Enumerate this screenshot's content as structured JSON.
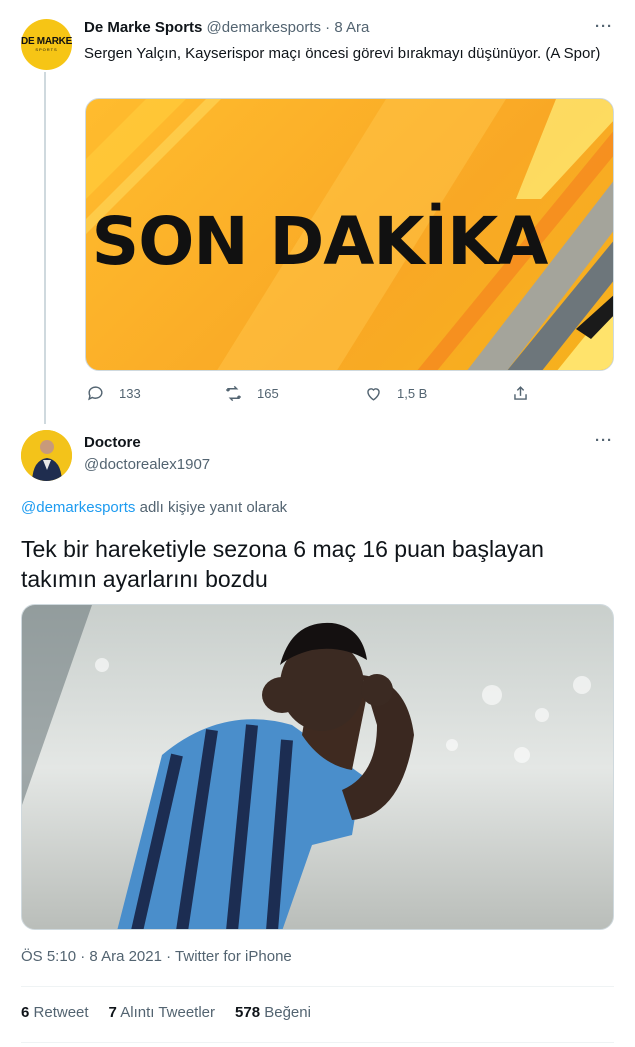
{
  "tweet1": {
    "avatar_logo_text": "DE MARKE",
    "avatar_logo_sub": "SPORTS",
    "name": "De Marke Sports",
    "handle": "@demarkesports",
    "separator": "·",
    "date": "8 Ara",
    "more": "···",
    "text": "Sergen Yalçın, Kayserispor maçı öncesi görevi bırakmayı düşünüyor. (A Spor)",
    "banner_text": "SON DAKİKA",
    "replies": "133",
    "retweets": "165",
    "likes": "1,5 B",
    "icons": [
      "reply-icon",
      "retweet-icon",
      "like-icon",
      "share-icon"
    ]
  },
  "tweet2": {
    "name": "Doctore",
    "handle": "@doctorealex1907",
    "more": "···",
    "reply_to_handle": "@demarkesports",
    "reply_to_suffix": " adlı kişiye yanıt olarak",
    "text": "Tek bir hareketiyle sezona 6 maç 16 puan başlayan takımın ayarlarını bozdu",
    "time": "ÖS 5:10",
    "sep": "·",
    "date": "8 Ara 2021",
    "source": "Twitter for iPhone",
    "stats": {
      "retweet_count": "6",
      "retweet_label": "Retweet",
      "quote_count": "7",
      "quote_label": "Alıntı Tweetler",
      "like_count": "578",
      "like_label": "Beğeni"
    }
  },
  "colors": {
    "accent": "#1d9bf0",
    "muted": "#536471",
    "banner_orange": "#f9a825",
    "avatar_yellow": "#f6c515"
  }
}
